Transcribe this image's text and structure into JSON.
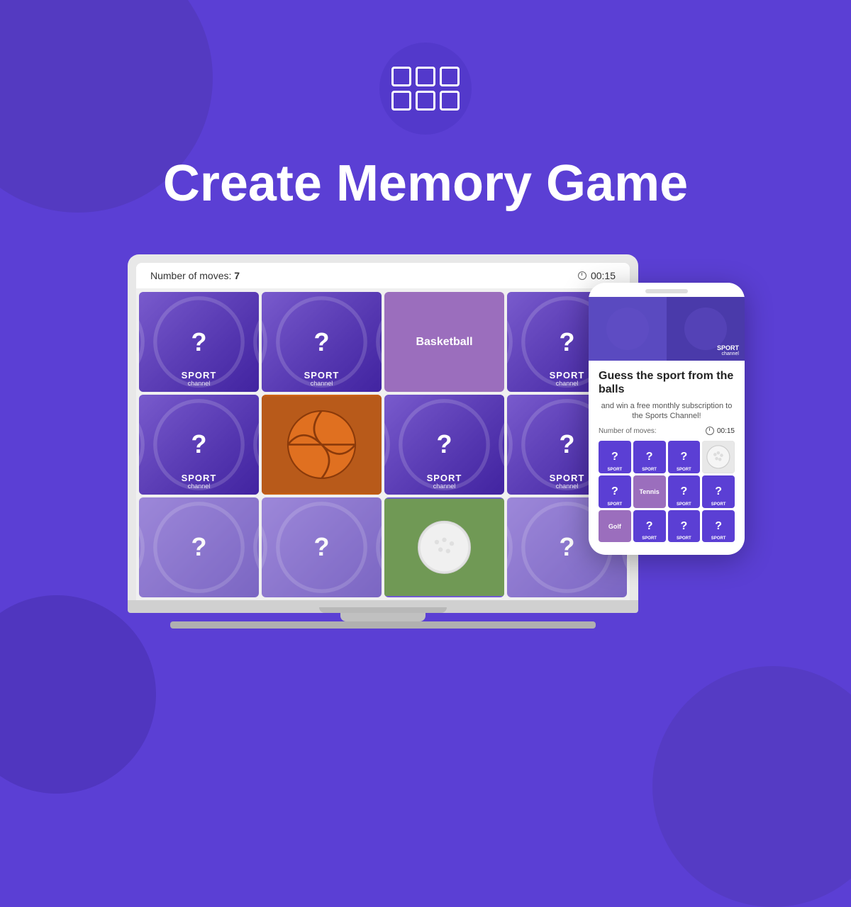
{
  "background": {
    "color": "#5b3fd4"
  },
  "logo": {
    "aria": "Memory Game Logo - grid of cards"
  },
  "title": "Create Memory Game",
  "laptop": {
    "header": {
      "moves_label": "Number of moves:",
      "moves_value": "7",
      "timer": "00:15"
    },
    "grid": [
      {
        "type": "hidden",
        "label_big": "SPORT",
        "label_small": "channel"
      },
      {
        "type": "hidden",
        "label_big": "SPORT",
        "label_small": "channel"
      },
      {
        "type": "revealed",
        "text": "Basketball"
      },
      {
        "type": "hidden",
        "label_big": "SPORT",
        "label_small": "channel"
      },
      {
        "type": "hidden",
        "label_big": "SPORT",
        "label_small": "channel"
      },
      {
        "type": "photo_basketball"
      },
      {
        "type": "hidden",
        "label_big": "SPORT",
        "label_small": "channel"
      },
      {
        "type": "hidden",
        "label_big": "SPORT",
        "label_small": "channel"
      },
      {
        "type": "partial"
      },
      {
        "type": "partial"
      },
      {
        "type": "partial_photo"
      },
      {
        "type": "partial"
      }
    ]
  },
  "phone": {
    "title": "Guess the sport from the balls",
    "subtitle": "and win a free monthly subscription to the Sports Channel!",
    "moves_label": "Number of moves:",
    "timer": "00:15",
    "sport_label_big": "SPORT",
    "sport_label_small": "channel",
    "grid": [
      {
        "type": "hidden",
        "label": "SPORT"
      },
      {
        "type": "hidden",
        "label": "SPORT"
      },
      {
        "type": "hidden",
        "label": "SPORT"
      },
      {
        "type": "photo_white"
      },
      {
        "type": "hidden",
        "label": "SPORT"
      },
      {
        "type": "tennis",
        "text": "Tennis"
      },
      {
        "type": "hidden",
        "label": "SPORT"
      },
      {
        "type": "hidden",
        "label": "SPORT"
      },
      {
        "type": "golf",
        "text": "Golf"
      },
      {
        "type": "hidden",
        "label": "SPORT"
      },
      {
        "type": "hidden",
        "label": "SPORT"
      },
      {
        "type": "hidden",
        "label": "SPORT"
      }
    ]
  }
}
